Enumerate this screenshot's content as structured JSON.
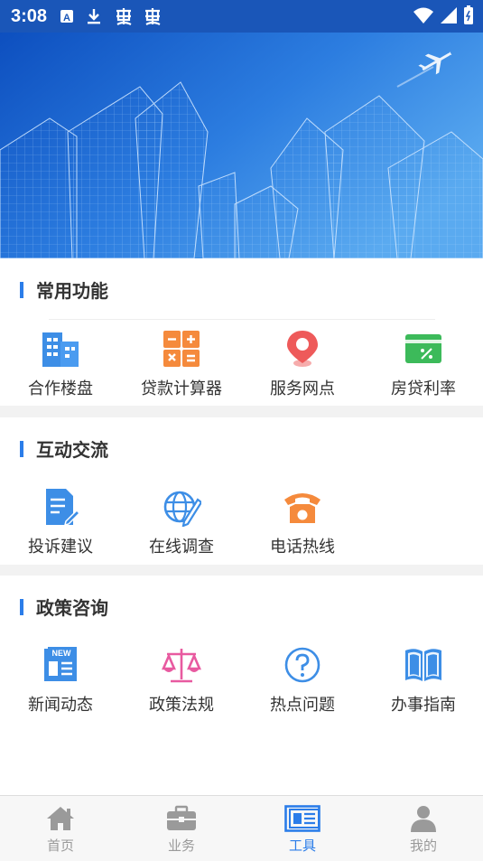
{
  "status_bar": {
    "time": "3:08"
  },
  "sections": [
    {
      "title": "常用功能",
      "items": [
        {
          "label": "合作楼盘",
          "icon": "building-icon",
          "color": "#3d8ee6"
        },
        {
          "label": "贷款计算器",
          "icon": "calculator-icon",
          "color": "#f58a3c"
        },
        {
          "label": "服务网点",
          "icon": "location-pin-icon",
          "color": "#ee5a5a"
        },
        {
          "label": "房贷利率",
          "icon": "percent-card-icon",
          "color": "#3cba5a"
        }
      ]
    },
    {
      "title": "互动交流",
      "items": [
        {
          "label": "投诉建议",
          "icon": "document-edit-icon",
          "color": "#3d8ee6"
        },
        {
          "label": "在线调查",
          "icon": "globe-pen-icon",
          "color": "#3d8ee6"
        },
        {
          "label": "电话热线",
          "icon": "telephone-icon",
          "color": "#f58a3c"
        }
      ]
    },
    {
      "title": "政策咨询",
      "items": [
        {
          "label": "新闻动态",
          "icon": "news-icon",
          "color": "#3d8ee6"
        },
        {
          "label": "政策法规",
          "icon": "scales-icon",
          "color": "#e85aa0"
        },
        {
          "label": "热点问题",
          "icon": "question-circle-icon",
          "color": "#3d8ee6"
        },
        {
          "label": "办事指南",
          "icon": "book-icon",
          "color": "#3d8ee6"
        }
      ]
    }
  ],
  "bottom_nav": [
    {
      "label": "首页",
      "icon": "home-icon",
      "active": false
    },
    {
      "label": "业务",
      "icon": "briefcase-icon",
      "active": false
    },
    {
      "label": "工具",
      "icon": "newspaper-icon",
      "active": true
    },
    {
      "label": "我的",
      "icon": "user-icon",
      "active": false
    }
  ],
  "colors": {
    "accent": "#2b7de9",
    "inactive": "#9a9a9a",
    "status_bar": "#1a56b8"
  }
}
